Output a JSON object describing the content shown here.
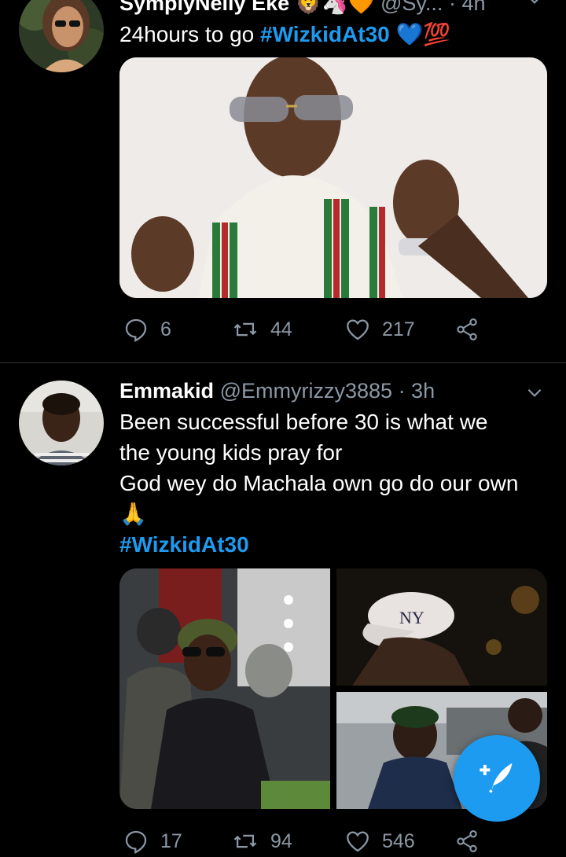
{
  "tweet1": {
    "display_name": "SymplyNelly Eke",
    "name_emojis": "🦁🦄🧡",
    "handle": "@Sy...",
    "time": "· 4h",
    "text": "24hours to go ",
    "hashtag": "#WizkidAt30",
    "emojis": "💙💯",
    "replies": "6",
    "retweets": "44",
    "likes": "217"
  },
  "tweet2": {
    "display_name": "Emmakid",
    "handle": "@Emmyrizzy3885",
    "time": "· 3h",
    "line1": "Been successful before 30 is what we",
    "line2": "the young kids pray for",
    "line3": "God wey do Machala own go do our own",
    "line4": "🙏",
    "hashtag": "#WizkidAt30",
    "replies": "17",
    "retweets": "94",
    "likes": "546"
  },
  "colors": {
    "background": "#000000",
    "accent": "#1d9bf0",
    "muted": "#8b98a5"
  },
  "icons": {
    "reply": "reply-icon",
    "retweet": "retweet-icon",
    "like": "heart-icon",
    "share": "share-icon",
    "chevron": "chevron-down-icon",
    "compose": "compose-tweet-icon"
  }
}
